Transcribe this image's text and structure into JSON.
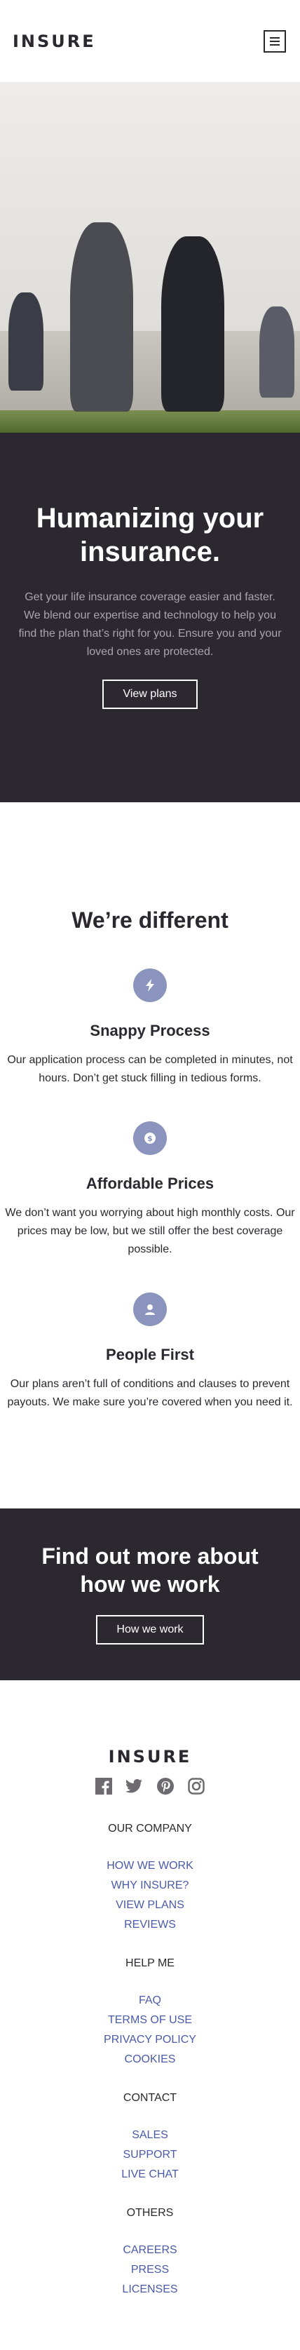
{
  "header": {
    "logo": "INSURE",
    "menu_icon": "hamburger-icon"
  },
  "hero": {
    "image_alt": "Family walking together holding hands",
    "title": "Humanizing your insurance.",
    "description": "Get your life insurance coverage easier and faster. We blend our expertise and technology to help you find the plan that’s right for you. Ensure you and your loved ones are protected.",
    "button_label": "View plans"
  },
  "different": {
    "title": "We’re different",
    "features": [
      {
        "icon": "lightning-icon",
        "title": "Snappy Process",
        "text": "Our application process can be completed in minutes, not hours. Don’t get stuck filling in tedious forms."
      },
      {
        "icon": "dollar-icon",
        "title": "Affordable Prices",
        "text": "We don’t want you worrying about high monthly costs. Our prices may be low, but we still offer the best coverage possible."
      },
      {
        "icon": "person-icon",
        "title": "People First",
        "text": "Our plans aren’t full of conditions and clauses to prevent payouts. We make sure you’re covered when you need it."
      }
    ]
  },
  "cta": {
    "title": "Find out more about how we work",
    "button_label": "How we work"
  },
  "footer": {
    "logo": "INSURE",
    "socials": [
      "facebook-icon",
      "twitter-icon",
      "pinterest-icon",
      "instagram-icon"
    ],
    "groups": [
      {
        "title": "OUR COMPANY",
        "links": [
          "HOW WE WORK",
          "WHY INSURE?",
          "VIEW PLANS",
          "REVIEWS"
        ]
      },
      {
        "title": "HELP ME",
        "links": [
          "FAQ",
          "TERMS OF USE",
          "PRIVACY POLICY",
          "COOKIES"
        ]
      },
      {
        "title": "CONTACT",
        "links": [
          "SALES",
          "SUPPORT",
          "LIVE CHAT"
        ]
      },
      {
        "title": "OTHERS",
        "links": [
          "CAREERS",
          "PRESS",
          "LICENSES"
        ]
      }
    ]
  }
}
